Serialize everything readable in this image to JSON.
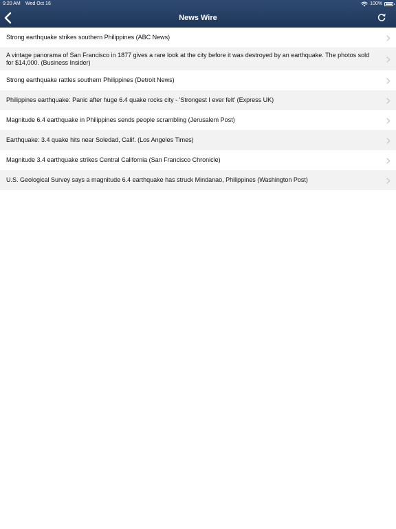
{
  "status_bar": {
    "time": "9:20 AM",
    "date": "Wed Oct 16",
    "battery": "100%"
  },
  "nav_bar": {
    "title": "News Wire",
    "back_icon": "chevron-left-icon",
    "refresh_icon": "refresh-icon"
  },
  "news": {
    "items": [
      {
        "headline": "Strong earthquake strikes southern Philippines (ABC News)"
      },
      {
        "headline": "A vintage panorama of San Francisco in 1877 gives a rare look at the city before it was destroyed by an earthquake. The photos sold for $14,000. (Business Insider)"
      },
      {
        "headline": "Strong earthquake rattles southern Philippines (Detroit News)"
      },
      {
        "headline": "Philippines earthquake: Panic after huge 6.4 quake rocks city - 'Strongest I ever felt' (Express UK)"
      },
      {
        "headline": "Magnitude 6.4 earthquake in Philippines sends people scrambling (Jerusalem Post)"
      },
      {
        "headline": "Earthquake: 3.4 quake hits near Soledad, Calif. (Los Angeles Times)"
      },
      {
        "headline": "Magnitude 3.4 earthquake strikes Central California (San Francisco Chronicle)"
      },
      {
        "headline": "U.S. Geological Survey says a magnitude 6.4 earthquake has struck Mindanao, Philippines (Washington Post)"
      }
    ]
  },
  "colors": {
    "nav_background": "#1e3658",
    "row_alt_background": "#f2f2f2",
    "chevron": "#c7c7cc"
  }
}
